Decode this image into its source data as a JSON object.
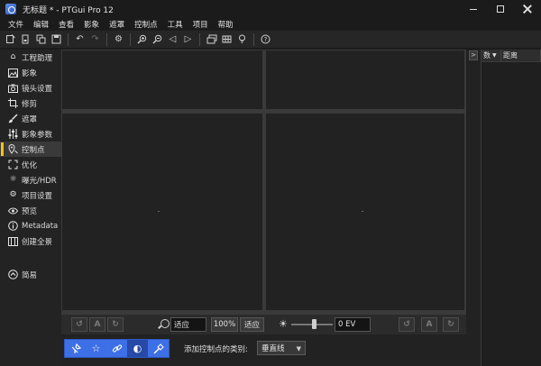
{
  "window": {
    "title": "无标题 * - PTGui Pro 12"
  },
  "menu": [
    "文件",
    "编辑",
    "查看",
    "影象",
    "遮罩",
    "控制点",
    "工具",
    "项目",
    "帮助"
  ],
  "toolbar": {
    "icons": [
      "new-project-icon",
      "open-project-icon",
      "copy-icon",
      "save-icon",
      "undo-icon",
      "redo-icon",
      "settings-icon",
      "zoom-in-icon",
      "zoom-out-icon",
      "previous-icon",
      "next-icon",
      "panorama-editor-icon",
      "grid-icon",
      "lightbulb-icon",
      "help-icon"
    ]
  },
  "sidebar": {
    "items": [
      {
        "label": "工程助理",
        "icon": "home-icon"
      },
      {
        "label": "影象",
        "icon": "image-icon"
      },
      {
        "label": "镜头设置",
        "icon": "camera-icon"
      },
      {
        "label": "修剪",
        "icon": "crop-icon"
      },
      {
        "label": "遮罩",
        "icon": "brush-icon"
      },
      {
        "label": "影象参数",
        "icon": "sliders-icon"
      },
      {
        "label": "控制点",
        "icon": "control-point-icon",
        "active": true
      },
      {
        "label": "优化",
        "icon": "optimize-icon"
      },
      {
        "label": "曝光/HDR",
        "icon": "exposure-icon"
      },
      {
        "label": "项目设置",
        "icon": "gear-icon"
      },
      {
        "label": "预览",
        "icon": "eye-icon"
      },
      {
        "label": "Metadata",
        "icon": "info-icon"
      },
      {
        "label": "创建全景",
        "icon": "panorama-icon"
      }
    ],
    "easy_label": "简易"
  },
  "controls": {
    "fit_value": "适应",
    "zoom_percent": "100%",
    "fit_button": "适应",
    "ev_value": "0 EV",
    "exposure_slider_level": 0.55
  },
  "bottom": {
    "cp_type_label": "添加控制点的类别:",
    "cp_type_value": "垂直线"
  },
  "right_panel": {
    "columns": [
      "数",
      "距离"
    ]
  }
}
